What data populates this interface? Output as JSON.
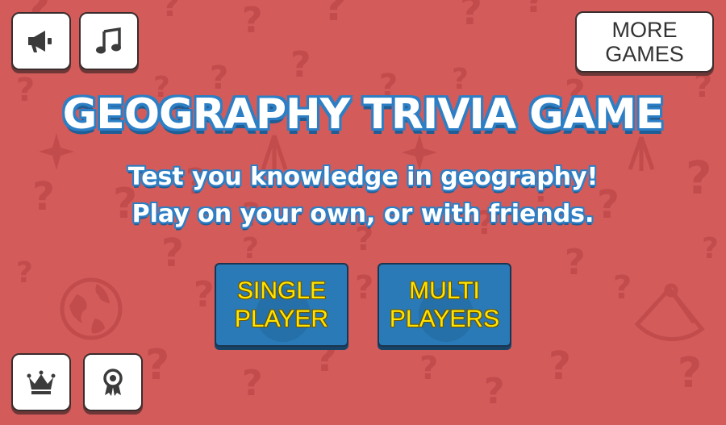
{
  "app": {
    "title": "GEOGRAPHY TRIVIA GAME"
  },
  "intro": {
    "line1": "Test you knowledge in geography!",
    "line2": "Play on your own, or with friends."
  },
  "top_left_buttons": [
    {
      "icon": "megaphone-icon"
    },
    {
      "icon": "music-note-icon"
    }
  ],
  "more_games": {
    "line1": "MORE",
    "line2": "GAMES"
  },
  "modes": [
    {
      "line1": "SINGLE",
      "line2": "PLAYER"
    },
    {
      "line1": "MULTI",
      "line2": "PLAYERS"
    }
  ],
  "bottom_left_buttons": [
    {
      "icon": "crown-icon"
    },
    {
      "icon": "ribbon-award-icon"
    }
  ],
  "background_pattern": {
    "glyph": "?"
  },
  "colors": {
    "background": "#d35b5a",
    "pattern": "#c24b4b",
    "title_outline": "#2d7fc5",
    "mode_button": "#2a7ab8",
    "mode_text": "#ffe400"
  }
}
